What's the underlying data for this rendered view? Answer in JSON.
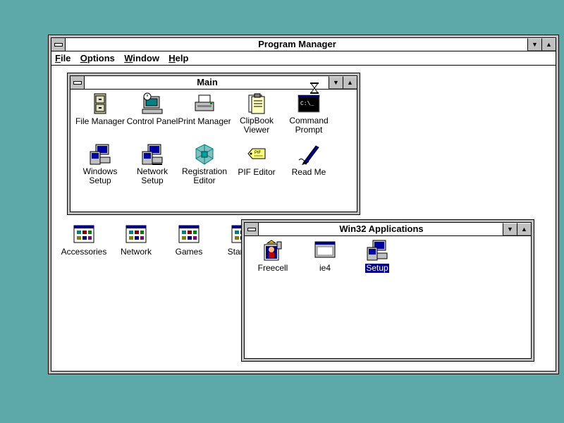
{
  "program_manager": {
    "title": "Program Manager",
    "menu": [
      "File",
      "Options",
      "Window",
      "Help"
    ]
  },
  "main_group": {
    "title": "Main",
    "items": [
      {
        "label": "File Manager",
        "icon": "file-manager-icon"
      },
      {
        "label": "Control Panel",
        "icon": "control-panel-icon"
      },
      {
        "label": "Print Manager",
        "icon": "printer-icon"
      },
      {
        "label": "ClipBook\nViewer",
        "icon": "clipbook-icon"
      },
      {
        "label": "Command\nPrompt",
        "icon": "command-prompt-icon"
      },
      {
        "label": "Windows\nSetup",
        "icon": "windows-setup-icon"
      },
      {
        "label": "Network Setup",
        "icon": "network-setup-icon"
      },
      {
        "label": "Registration\nEditor",
        "icon": "registry-editor-icon"
      },
      {
        "label": "PIF Editor",
        "icon": "pif-editor-icon"
      },
      {
        "label": "Read Me",
        "icon": "read-me-icon"
      }
    ]
  },
  "minimized_groups": [
    {
      "label": "Accessories"
    },
    {
      "label": "Network"
    },
    {
      "label": "Games"
    },
    {
      "label": "StartUp"
    }
  ],
  "win32_group": {
    "title": "Win32 Applications",
    "items": [
      {
        "label": "Freecell",
        "icon": "freecell-icon"
      },
      {
        "label": "ie4",
        "icon": "window-icon"
      },
      {
        "label": "Setup",
        "icon": "setup-icon",
        "selected": true
      }
    ]
  },
  "colors": {
    "desktop": "#5da8a8",
    "selection": "#000080"
  }
}
